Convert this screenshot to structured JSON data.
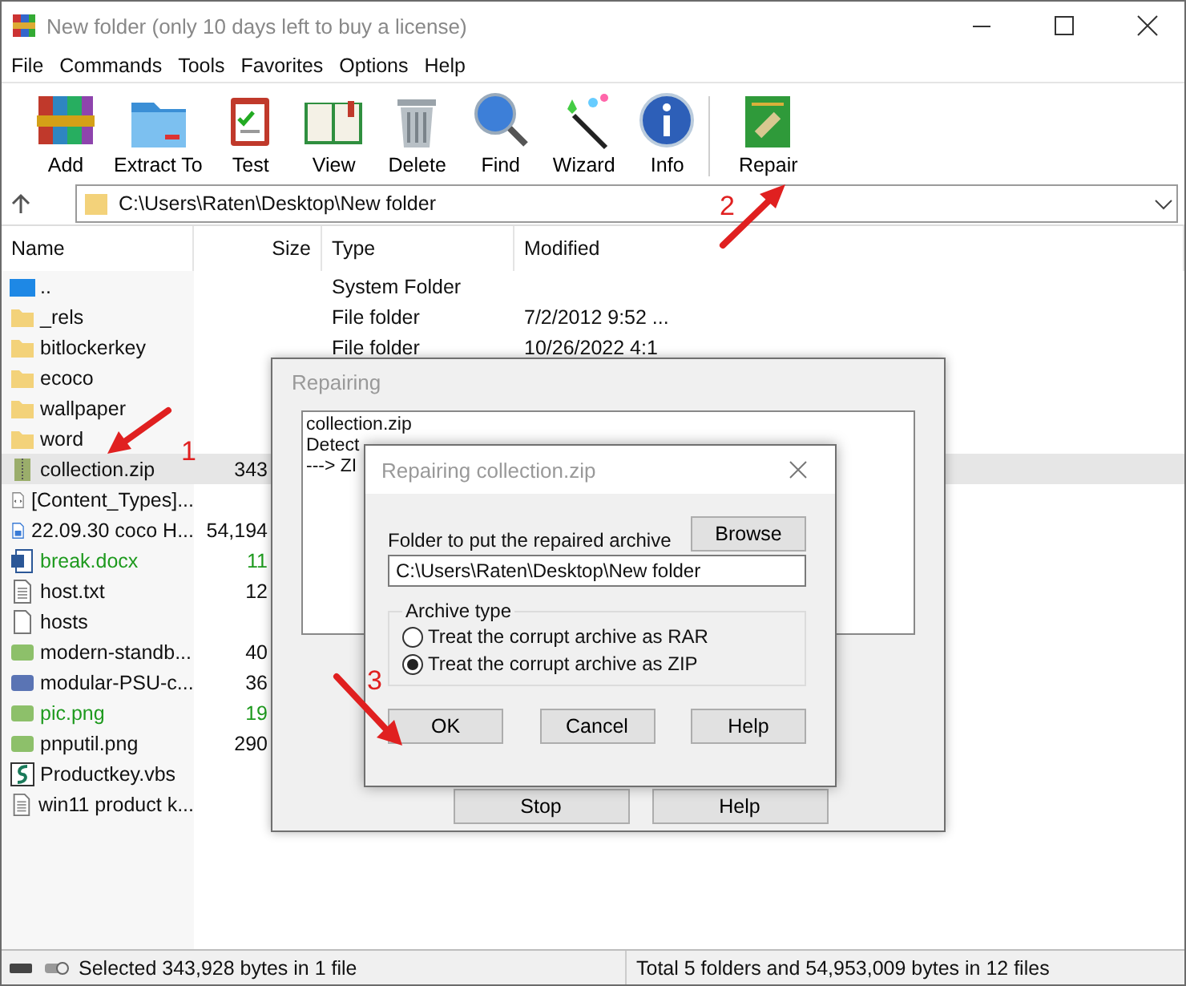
{
  "window": {
    "title": "New folder (only 10 days left to buy a license)"
  },
  "menu": [
    "File",
    "Commands",
    "Tools",
    "Favorites",
    "Options",
    "Help"
  ],
  "toolbar": [
    {
      "label": "Add"
    },
    {
      "label": "Extract To"
    },
    {
      "label": "Test"
    },
    {
      "label": "View"
    },
    {
      "label": "Delete"
    },
    {
      "label": "Find"
    },
    {
      "label": "Wizard"
    },
    {
      "label": "Info"
    },
    {
      "label": "Repair"
    }
  ],
  "address": {
    "value": "C:\\Users\\Raten\\Desktop\\New folder"
  },
  "columns": [
    "Name",
    "Size",
    "Type",
    "Modified"
  ],
  "files": [
    {
      "name": "..",
      "kind": "parent",
      "type": "System Folder",
      "selected": false
    },
    {
      "name": "_rels",
      "kind": "folder",
      "type": "File folder",
      "modified": "7/2/2012 9:52 ...",
      "selected": false
    },
    {
      "name": "bitlockerkey",
      "kind": "folder",
      "type": "File folder",
      "modified": "10/26/2022 4:1",
      "selected": false
    },
    {
      "name": "ecoco",
      "kind": "folder",
      "selected": false
    },
    {
      "name": "wallpaper",
      "kind": "folder",
      "selected": false
    },
    {
      "name": "word",
      "kind": "folder",
      "selected": false
    },
    {
      "name": "collection.zip",
      "kind": "zip",
      "size": "343",
      "selected": true
    },
    {
      "name": "[Content_Types]...",
      "kind": "xml",
      "selected": false
    },
    {
      "name": "22.09.30 coco H...",
      "kind": "video",
      "size": "54,194",
      "selected": false
    },
    {
      "name": "break.docx",
      "kind": "docx",
      "size": "11",
      "color": "#1e9a1e",
      "selected": false
    },
    {
      "name": "host.txt",
      "kind": "text",
      "size": "12",
      "selected": false
    },
    {
      "name": "hosts",
      "kind": "blank",
      "selected": false
    },
    {
      "name": "modern-standb...",
      "kind": "png",
      "size": "40",
      "selected": false
    },
    {
      "name": "modular-PSU-c...",
      "kind": "pic",
      "size": "36",
      "selected": false
    },
    {
      "name": "pic.png",
      "kind": "png",
      "size": "19",
      "color": "#1e9a1e",
      "selected": false
    },
    {
      "name": "pnputil.png",
      "kind": "png",
      "size": "290",
      "selected": false
    },
    {
      "name": "Productkey.vbs",
      "kind": "script",
      "selected": false
    },
    {
      "name": "win11 product k...",
      "kind": "text",
      "selected": false
    }
  ],
  "repairing_dialog": {
    "title": "Repairing",
    "log": [
      "collection.zip",
      "Detect",
      "---> ZI"
    ],
    "buttons": [
      "Stop",
      "Help"
    ]
  },
  "repair_dialog": {
    "title": "Repairing collection.zip",
    "folder_label": "Folder to put the repaired archive",
    "browse": "Browse",
    "folder": "C:\\Users\\Raten\\Desktop\\New folder",
    "group": "Archive type",
    "options": [
      {
        "label": "Treat the corrupt archive as RAR",
        "selected": false
      },
      {
        "label": "Treat the corrupt archive as ZIP",
        "selected": true
      }
    ],
    "buttons": [
      "OK",
      "Cancel",
      "Help"
    ]
  },
  "annotations": [
    {
      "label": "1"
    },
    {
      "label": "2"
    },
    {
      "label": "3"
    }
  ],
  "status": {
    "left": "Selected 343,928 bytes in 1 file",
    "right": "Total 5 folders and 54,953,009 bytes in 12 files"
  }
}
